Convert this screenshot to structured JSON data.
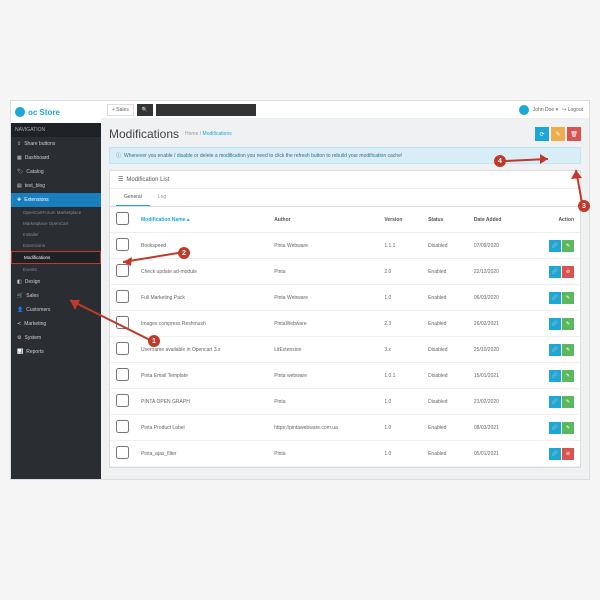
{
  "logo": "oc Store",
  "nav_header": "NAVIGATION",
  "top": {
    "sales": "+ Sales",
    "user": "John Doe",
    "logout": "Logout"
  },
  "nav": {
    "share": "Share buttons",
    "dashboard": "Dashboard",
    "catalog": "Catalog",
    "test_blog": "test_blog",
    "extensions": "Extensions",
    "sub_market": "OpenCartForum Marketplace",
    "sub_market2": "Marketplace OpenCart",
    "sub_installer": "Installer",
    "sub_ext": "Extensions",
    "sub_mods": "Modifications",
    "sub_events": "Events",
    "design": "Design",
    "sales_nav": "Sales",
    "customers": "Customers",
    "marketing": "Marketing",
    "system": "System",
    "reports": "Reports"
  },
  "page": {
    "title": "Modifications",
    "bc_home": "Home",
    "bc_current": "Modifications"
  },
  "alert": "Whenever you enable / disable or delete a modification you need to click the refresh button to rebuild your modification cache!",
  "panel_title": "Modification List",
  "tabs": {
    "general": "General",
    "log": "Log"
  },
  "cols": {
    "name": "Modification Name",
    "author": "Author",
    "version": "Version",
    "status": "Status",
    "date": "Date Added",
    "action": "Action"
  },
  "rows": [
    {
      "name": "Bookspeed",
      "author": "Pinta Webware",
      "version": "1.1.1",
      "status": "Disabled",
      "date": "07/09/2020",
      "edit": true
    },
    {
      "name": "Check update ad-module",
      "author": "Pinta",
      "version": "2.0",
      "status": "Enabled",
      "date": "22/12/2020",
      "edit": false
    },
    {
      "name": "Full Marketing Pack",
      "author": "Pinta Webware",
      "version": "1.0",
      "status": "Enabled",
      "date": "06/03/2020",
      "edit": true
    },
    {
      "name": "Images compress Reshmush",
      "author": "PintaWebware",
      "version": "2.3",
      "status": "Enabled",
      "date": "26/02/2021",
      "edit": true
    },
    {
      "name": "Username available in Opencart 3.x",
      "author": "LitExtension",
      "version": "3.x",
      "status": "Disabled",
      "date": "25/10/2020",
      "edit": true
    },
    {
      "name": "Pinta Email Template",
      "author": "Pinta webware",
      "version": "1.0.1",
      "status": "Disabled",
      "date": "15/01/2021",
      "edit": true
    },
    {
      "name": "PINTA OPEN GRAPH",
      "author": "Pinta",
      "version": "1.0",
      "status": "Disabled",
      "date": "21/02/2020",
      "edit": true
    },
    {
      "name": "Pinta Product Label",
      "author": "https://pintawebware.com.ua",
      "version": "1.0",
      "status": "Enabled",
      "date": "08/03/2021",
      "edit": true
    },
    {
      "name": "Pinta_ajax_filter",
      "author": "Pinta",
      "version": "1.0",
      "status": "Enabled",
      "date": "05/01/2021",
      "edit": false
    }
  ]
}
